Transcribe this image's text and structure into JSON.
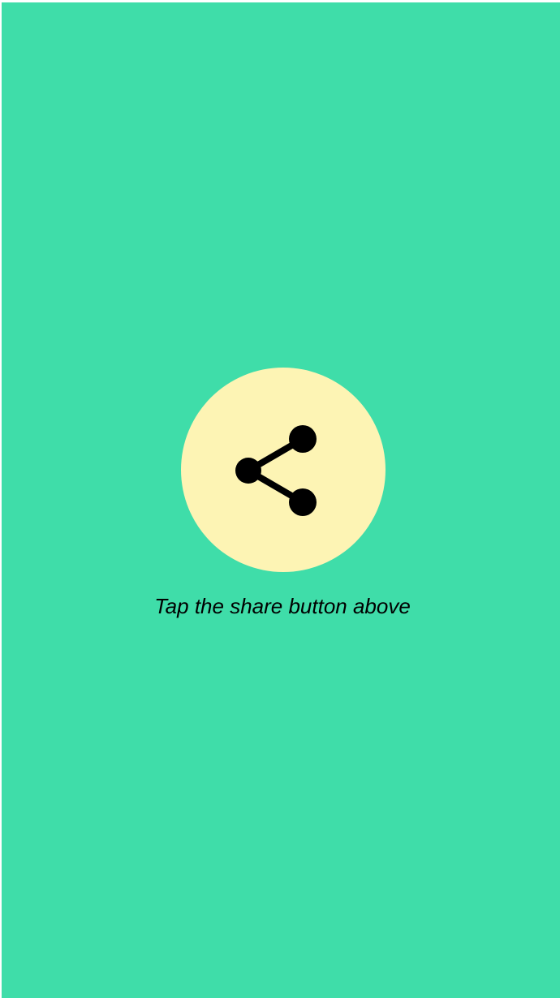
{
  "colors": {
    "background": "#3fdda9",
    "button_fill": "#fdf4b4",
    "icon": "#000000",
    "text": "#000000"
  },
  "share": {
    "icon": "share-icon",
    "caption": "Tap the share button above"
  }
}
